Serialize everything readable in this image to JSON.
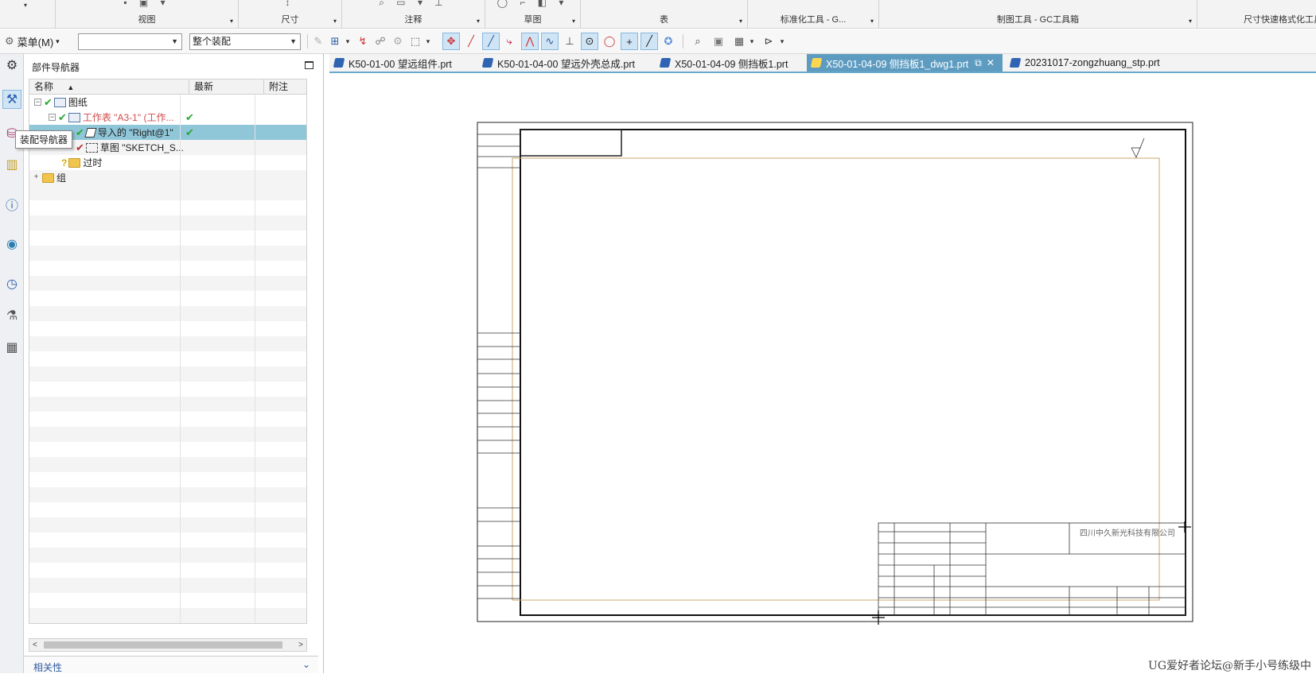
{
  "ribbon": {
    "groups": [
      "视图",
      "尺寸",
      "注释",
      "草图",
      "表",
      "标准化工具 - G...",
      "制图工具 - GC工具箱",
      "尺寸快速格式化工具"
    ]
  },
  "toolbar": {
    "menu_label": "菜单(M)",
    "selection_filter_value": "",
    "scope_value": "整个装配"
  },
  "navigator": {
    "title": "部件导航器",
    "columns": [
      "名称",
      "最新",
      "附注"
    ],
    "tooltip": "装配导航器",
    "tree": [
      {
        "label": "图纸",
        "latest": "",
        "depth": 0
      },
      {
        "label": "工作表 \"A3-1\" (工作...",
        "latest": "✔",
        "depth": 1
      },
      {
        "label": "导入的 \"Right@1\"",
        "latest": "✔",
        "depth": 2
      },
      {
        "label": "草图 \"SKETCH_S...",
        "latest": "",
        "depth": 2
      },
      {
        "label": "过时",
        "latest": "",
        "depth": 2
      },
      {
        "label": "组",
        "latest": "",
        "depth": 0
      }
    ],
    "related_label": "相关性"
  },
  "tabs": [
    {
      "label": "K50-01-00 望远组件.prt",
      "active": false
    },
    {
      "label": "K50-01-04-00 望远外壳总成.prt",
      "active": false
    },
    {
      "label": "X50-01-04-09 侧挡板1.prt",
      "active": false
    },
    {
      "label": "X50-01-04-09 侧挡板1_dwg1.prt",
      "active": true
    },
    {
      "label": "20231017-zongzhuang_stp.prt",
      "active": false
    }
  ],
  "titleblock": {
    "company": "四川中久新光科技有限公司"
  },
  "watermark": "UG爱好者论坛@新手小号练级中",
  "colors": {
    "tab_active": "#5d9cc0",
    "row_selected": "#8fc7d9",
    "check_green": "#2aa832",
    "margin_line": "#c9a86b"
  }
}
